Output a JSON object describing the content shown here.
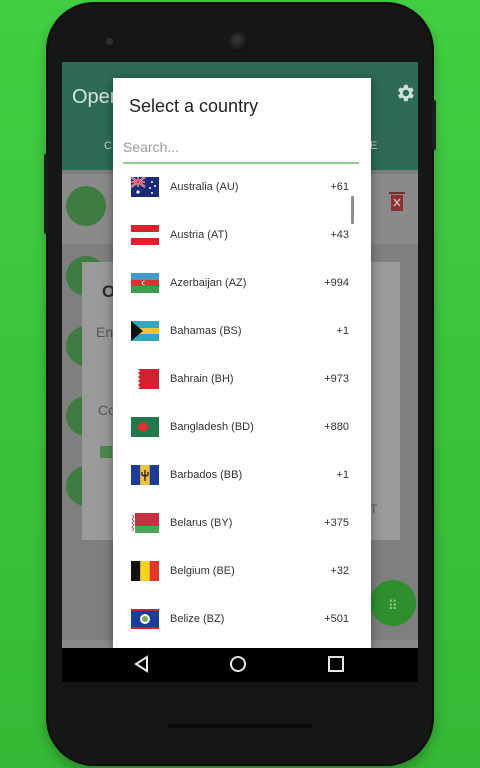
{
  "app": {
    "title_partial": "Open",
    "tab_left_partial": "C",
    "tab_right_partial": "E",
    "inner_dialog": {
      "title_partial": "O",
      "field1_partial": "Ent",
      "field2_partial": "Co",
      "button_partial": "T"
    }
  },
  "dialog": {
    "title": "Select a country",
    "search_placeholder": "Search..."
  },
  "countries": [
    {
      "name": "Australia (AU)",
      "code": "+61"
    },
    {
      "name": "Austria (AT)",
      "code": "+43"
    },
    {
      "name": "Azerbaijan (AZ)",
      "code": "+994"
    },
    {
      "name": "Bahamas (BS)",
      "code": "+1"
    },
    {
      "name": "Bahrain (BH)",
      "code": "+973"
    },
    {
      "name": "Bangladesh (BD)",
      "code": "+880"
    },
    {
      "name": "Barbados (BB)",
      "code": "+1"
    },
    {
      "name": "Belarus (BY)",
      "code": "+375"
    },
    {
      "name": "Belgium (BE)",
      "code": "+32"
    },
    {
      "name": "Belize (BZ)",
      "code": "+501"
    }
  ],
  "colors": {
    "background": "#3cc83c",
    "app_bar": "#2d6b58",
    "accent": "#8ccf8c"
  },
  "icons": {
    "settings": "gear-icon",
    "delete": "trash-icon",
    "dialpad": "dialpad-icon",
    "back": "back-icon",
    "home": "home-icon",
    "recents": "recents-icon"
  }
}
